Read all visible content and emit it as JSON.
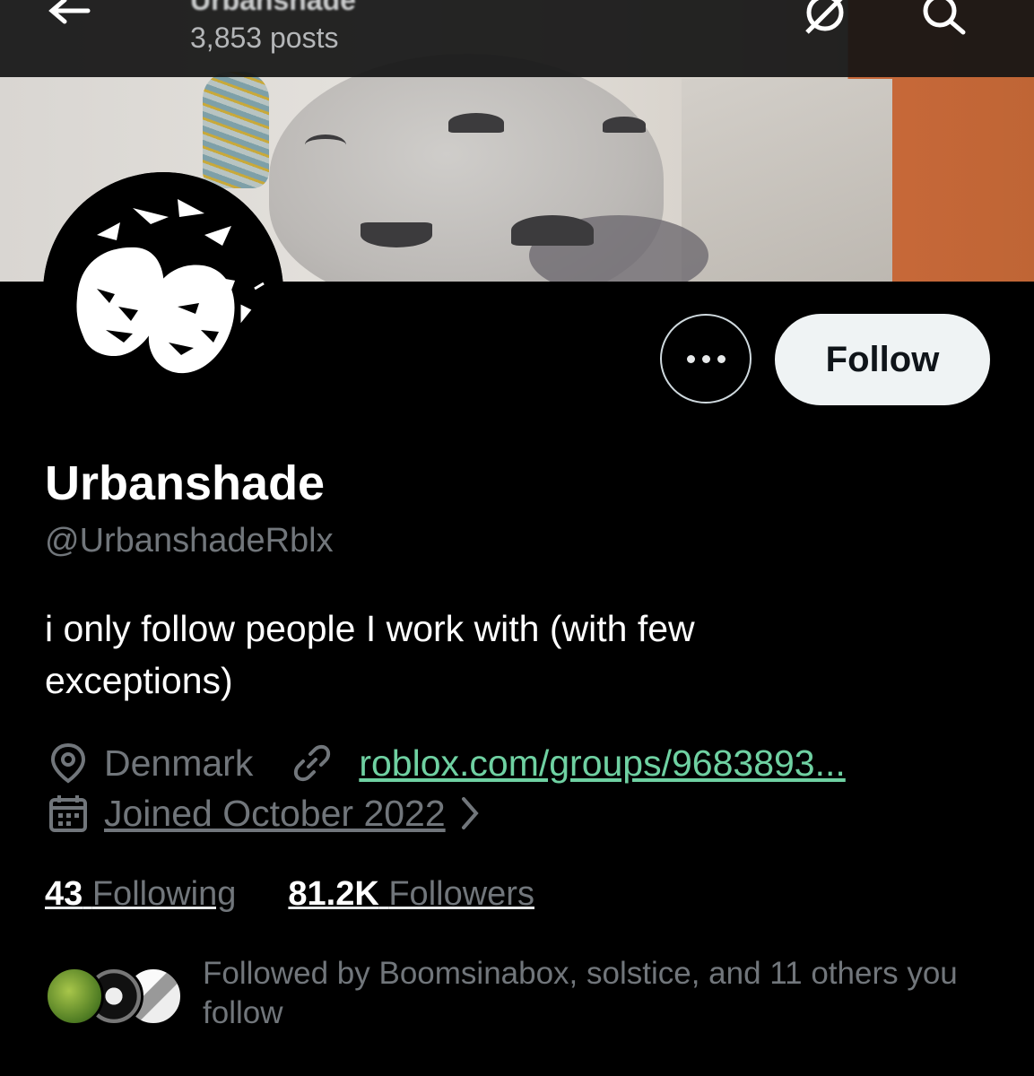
{
  "header": {
    "title": "Urbanshade",
    "posts_count": "3,853 posts",
    "icons": [
      "back-arrow-icon",
      "grok-icon",
      "search-icon"
    ]
  },
  "profile": {
    "display_name": "Urbanshade",
    "handle": "@UrbanshadeRblx",
    "bio": "i only follow people I work with (with few exceptions)",
    "location": "Denmark",
    "link": "roblox.com/groups/9683893...",
    "joined": "Joined October 2022"
  },
  "actions": {
    "more_label": "•••",
    "follow_label": "Follow"
  },
  "stats": {
    "following_count": "43",
    "following_label": "Following",
    "followers_count": "81.2K",
    "followers_label": "Followers"
  },
  "followed_by": {
    "text": "Followed by Boomsinabox, solstice, and 11 others you follow"
  },
  "colors": {
    "background": "#000000",
    "link": "#6fd1a2",
    "muted": "#71767b",
    "follow_button_bg": "#eff3f4"
  }
}
